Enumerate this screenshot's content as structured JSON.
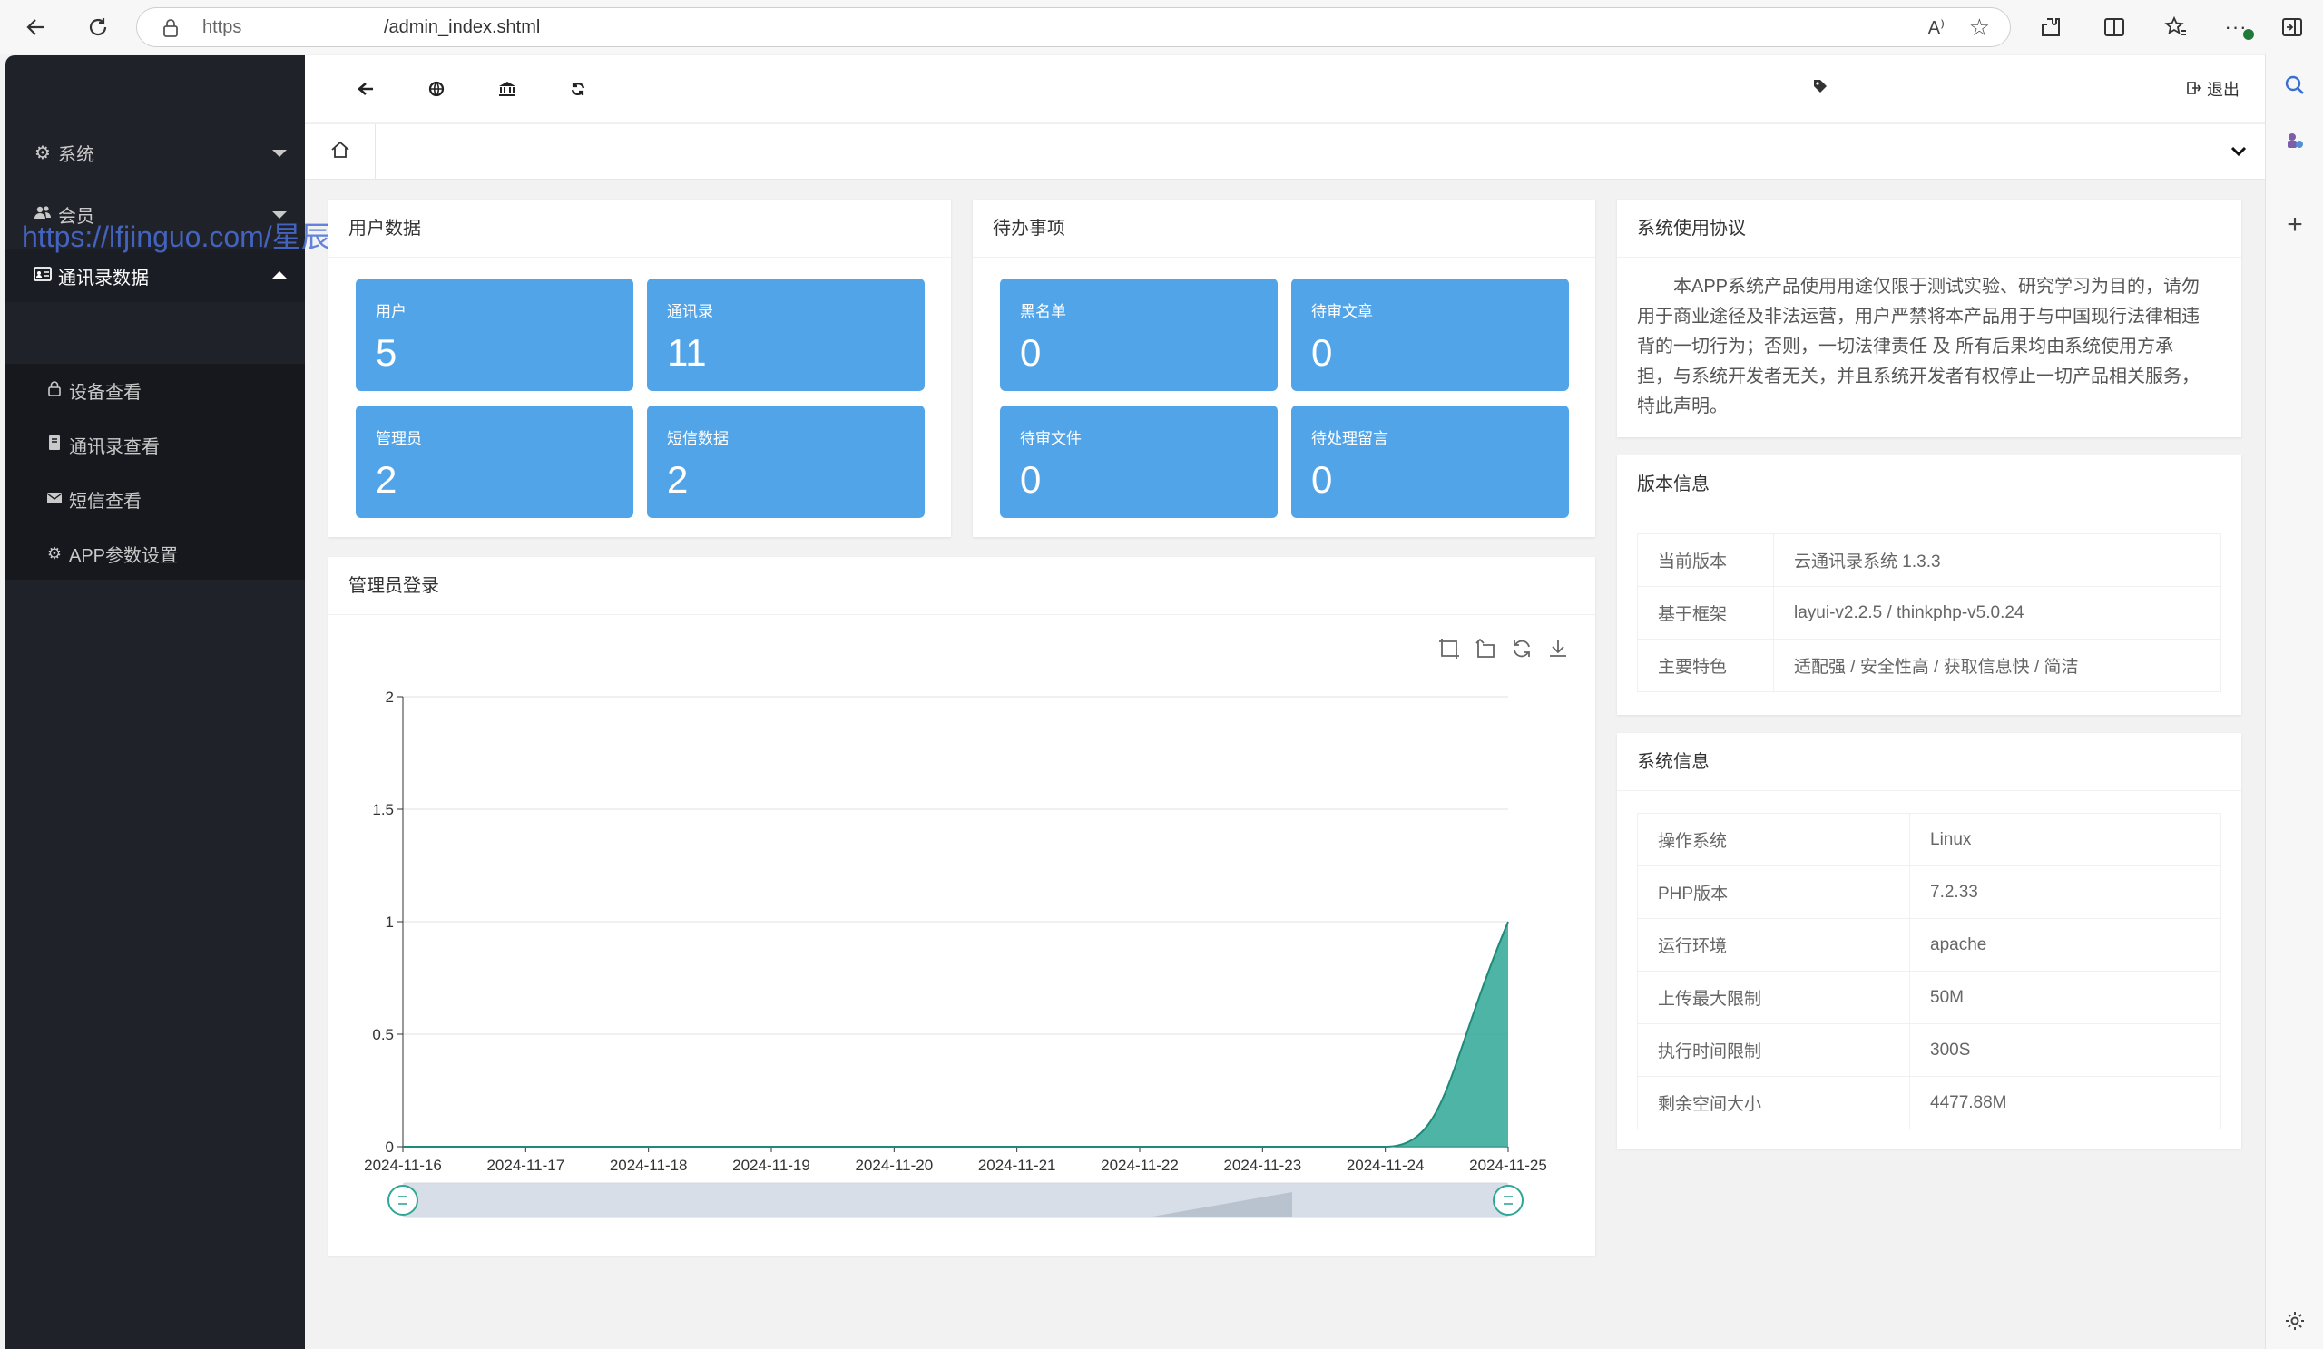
{
  "browser": {
    "url_scheme": "https",
    "url_path": "/admin_index.shtml",
    "read_aloud": "A⁾"
  },
  "sidebar": {
    "watermark": "https://lfjinguo.com/星辰源码城",
    "items": [
      {
        "label": "系统",
        "icon": "gear-icon"
      },
      {
        "label": "会员",
        "icon": "users-icon"
      },
      {
        "label": "通讯录数据",
        "icon": "id-card-icon"
      }
    ],
    "subitems": [
      {
        "label": "设备查看",
        "icon": "lock-icon"
      },
      {
        "label": "通讯录查看",
        "icon": "book-icon"
      },
      {
        "label": "短信查看",
        "icon": "envelope-icon"
      },
      {
        "label": "APP参数设置",
        "icon": "gear-icon"
      }
    ]
  },
  "topbar": {
    "logout_label": "退出"
  },
  "user_data": {
    "title": "用户数据",
    "tiles": [
      {
        "label": "用户",
        "value": "5"
      },
      {
        "label": "通讯录",
        "value": "11"
      },
      {
        "label": "管理员",
        "value": "2"
      },
      {
        "label": "短信数据",
        "value": "2"
      }
    ]
  },
  "todo": {
    "title": "待办事项",
    "tiles": [
      {
        "label": "黑名单",
        "value": "0"
      },
      {
        "label": "待审文章",
        "value": "0"
      },
      {
        "label": "待审文件",
        "value": "0"
      },
      {
        "label": "待处理留言",
        "value": "0"
      }
    ]
  },
  "agreement": {
    "title": "系统使用协议",
    "text": "本APP系统产品使用用途仅限于测试实验、研究学习为目的，请勿用于商业途径及非法运营，用户严禁将本产品用于与中国现行法律相违背的一切行为；否则，一切法律责任 及 所有后果均由系统使用方承担，与系统开发者无关，并且系统开发者有权停止一切产品相关服务，特此声明。"
  },
  "version": {
    "title": "版本信息",
    "rows": [
      {
        "k": "当前版本",
        "v": "云通讯录系统 1.3.3"
      },
      {
        "k": "基于框架",
        "v": "layui-v2.2.5 / thinkphp-v5.0.24"
      },
      {
        "k": "主要特色",
        "v": "适配强 / 安全性高 / 获取信息快 / 简洁"
      }
    ]
  },
  "sysinfo": {
    "title": "系统信息",
    "rows": [
      {
        "k": "操作系统",
        "v": "Linux"
      },
      {
        "k": "PHP版本",
        "v": "7.2.33"
      },
      {
        "k": "运行环境",
        "v": "apache"
      },
      {
        "k": "上传最大限制",
        "v": "50M"
      },
      {
        "k": "执行时间限制",
        "v": "300S"
      },
      {
        "k": "剩余空间大小",
        "v": "4477.88M"
      }
    ]
  },
  "chart_card": {
    "title": "管理员登录"
  },
  "chart_data": {
    "type": "area",
    "x": [
      "2024-11-16",
      "2024-11-17",
      "2024-11-18",
      "2024-11-19",
      "2024-11-20",
      "2024-11-21",
      "2024-11-22",
      "2024-11-23",
      "2024-11-24",
      "2024-11-25"
    ],
    "values": [
      0,
      0,
      0,
      0,
      0,
      0,
      0,
      0,
      0,
      1
    ],
    "ylim": [
      0,
      2
    ],
    "yticks": [
      "0",
      "0.5",
      "1",
      "1.5",
      "2"
    ],
    "grid": true,
    "color": "#2fa796",
    "data_zoom": [
      0,
      100
    ]
  },
  "colors": {
    "tile": "#52a4e8",
    "sidebar": "#20222a",
    "chart": "#2fa796"
  }
}
